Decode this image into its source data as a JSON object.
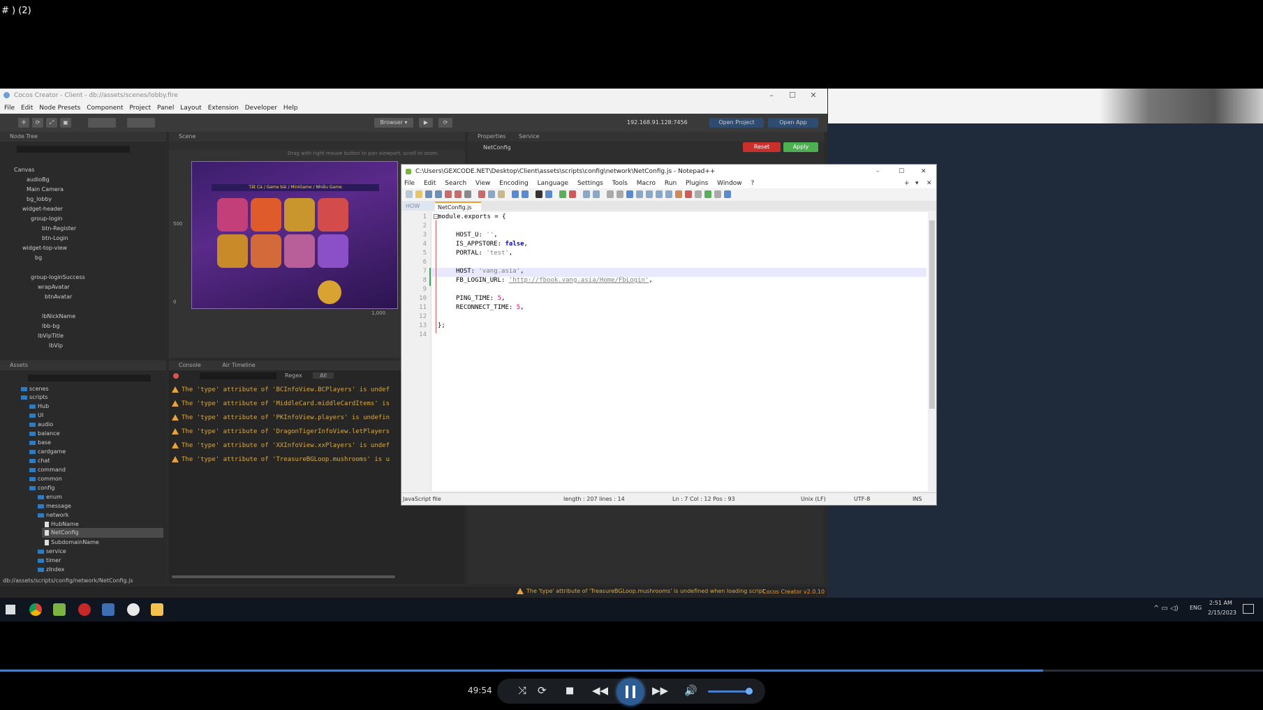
{
  "top_caption": "# ) (2)",
  "cocos": {
    "title": "Cocos Creator - Client - db://assets/scenes/lobby.fire",
    "menu": [
      "File",
      "Edit",
      "Node Presets",
      "Component",
      "Project",
      "Panel",
      "Layout",
      "Extension",
      "Developer",
      "Help"
    ],
    "browser_label": "Browser",
    "ip": "192.168.91.128:7456",
    "open_project": "Open Project",
    "open_app": "Open App",
    "node_tree_title": "Node Tree",
    "node_tree": [
      "Canvas",
      "audioBg",
      "Main Camera",
      "bg_lobby",
      "widget-header",
      "group-login",
      "btn-Register",
      "btn-Login",
      "widget-top-view",
      "bg",
      "group-loginSuccess",
      "wrapAvatar",
      "btnAvatar",
      "lbNickName",
      "lbb-bg",
      "lbVipTitle",
      "lbVip"
    ],
    "scene_tab": "Scene",
    "scene_hint": "Drag with right mouse button to pan viewport, scroll to zoom.",
    "properties_tab": "Properties",
    "service_tab": "Service",
    "prop_node": "NetConfig",
    "reset": "Reset",
    "apply": "Apply",
    "console_tab": "Console",
    "anim_tab": "Air Timeline",
    "console_regex": "Regex",
    "console_all": "All",
    "console_lines": [
      "The 'type' attribute of 'BCInfoView.BCPlayers' is undef",
      "The 'type' attribute of 'MiddleCard.middleCardItems' is",
      "The 'type' attribute of 'PKInfoView.players' is undefin",
      "The 'type' attribute of 'DragonTigerInfoView.letPlayers",
      "The 'type' attribute of 'XXInfoView.xxPlayers' is undef",
      "The 'type' attribute of 'TreasureBGLoop.mushrooms' is u"
    ],
    "assets_title": "Assets",
    "assets": [
      "scenes",
      "scripts",
      "Hub",
      "UI",
      "audio",
      "balance",
      "base",
      "cardgame",
      "chat",
      "command",
      "common",
      "config",
      "enum",
      "message",
      "network",
      "HubName",
      "NetConfig",
      "SubdomainName",
      "service",
      "timer",
      "zIndex"
    ],
    "asset_path": "db://assets/scripts/config/network/NetConfig.js",
    "status_warning": "The 'type' attribute of 'TreasureBGLoop.mushrooms' is undefined when loading script",
    "version": "Cocos Creator v2.0.10",
    "scene_axis": [
      "500",
      "0",
      "1,000"
    ],
    "game_banner": "Tất Cả  /  Game bài  /  MiniGame  /  Nhiều Game"
  },
  "npp": {
    "title": "C:\\Users\\GEXCODE.NET\\Desktop\\Client\\assets\\scripts\\config\\network\\NetConfig.js - Notepad++",
    "menu": [
      "File",
      "Edit",
      "Search",
      "View",
      "Encoding",
      "Language",
      "Settings",
      "Tools",
      "Macro",
      "Run",
      "Plugins",
      "Window",
      "?"
    ],
    "tab1": "HOW",
    "tab2": "NetConfig.js",
    "line_numbers": [
      "1",
      "2",
      "3",
      "4",
      "5",
      "6",
      "7",
      "8",
      "9",
      "10",
      "11",
      "12",
      "13",
      "14"
    ],
    "status": {
      "type": "JavaScript file",
      "length": "length : 207   lines : 14",
      "pos": "Ln : 7   Col : 12   Pos : 93",
      "eol": "Unix (LF)",
      "enc": "UTF-8",
      "ins": "INS"
    }
  },
  "taskbar": {
    "lang": "ENG",
    "time": "2:51 AM",
    "date": "2/15/2023"
  },
  "player": {
    "timecode": "49:54",
    "progress_fraction": 0.826,
    "volume_fraction": 0.85
  },
  "colors": {
    "accent_blue": "#4a7fc7",
    "warning": "#e8a23a",
    "reset_red": "#c9302c",
    "apply_green": "#4caf50"
  }
}
